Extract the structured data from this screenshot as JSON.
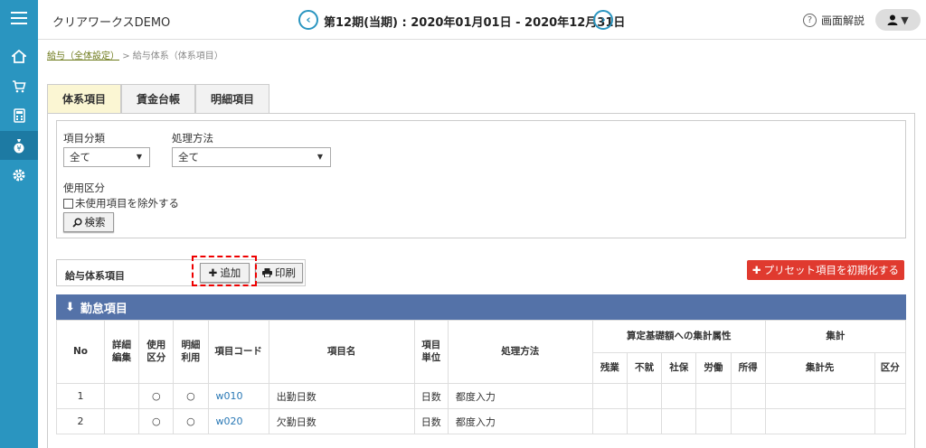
{
  "header": {
    "app_title": "クリアワークスDEMO",
    "period": "第12期(当期) : 2020年01月01日 - 2020年12月31日",
    "help_label": "画面解説"
  },
  "breadcrumb": {
    "link": "給与（全体設定）",
    "separator": ">",
    "current": "給与体系（体系項目）"
  },
  "tabs": [
    {
      "label": "体系項目",
      "active": true
    },
    {
      "label": "賃金台帳",
      "active": false
    },
    {
      "label": "明細項目",
      "active": false
    }
  ],
  "filter": {
    "category_label": "項目分類",
    "category_value": "全て",
    "method_label": "処理方法",
    "method_value": "全て",
    "usage_label": "使用区分",
    "exclude_unused_label": "未使用項目を除外する",
    "search_label": "検索"
  },
  "actions": {
    "label": "給与体系項目",
    "add_label": "追加",
    "print_label": "印刷",
    "preset_label": "プリセット項目を初期化する"
  },
  "section": {
    "title": "勤怠項目"
  },
  "table": {
    "headers": {
      "no": "No",
      "detail_edit": "詳細\n編集",
      "usage": "使用\n区分",
      "detail_use": "明細\n利用",
      "code": "項目コード",
      "name": "項目名",
      "unit": "項目\n単位",
      "method": "処理方法",
      "basis_group": "算定基礎額への集計属性",
      "aggregate_group": "集計",
      "overtime": "残業",
      "absence": "不就",
      "social": "社保",
      "labor": "労働",
      "income": "所得",
      "target": "集計先",
      "division": "区分"
    },
    "rows": [
      {
        "no": "1",
        "usage": "○",
        "detail_use": "○",
        "code": "w010",
        "name": "出勤日数",
        "unit": "日数",
        "method": "都度入力"
      },
      {
        "no": "2",
        "usage": "○",
        "detail_use": "○",
        "code": "w020",
        "name": "欠勤日数",
        "unit": "日数",
        "method": "都度入力"
      }
    ]
  },
  "colors": {
    "sidebar": "#2a95c0",
    "section_header": "#5472a8",
    "preset_button": "#e03a2f",
    "active_tab": "#fbf6d3",
    "link": "#2a78b5"
  }
}
